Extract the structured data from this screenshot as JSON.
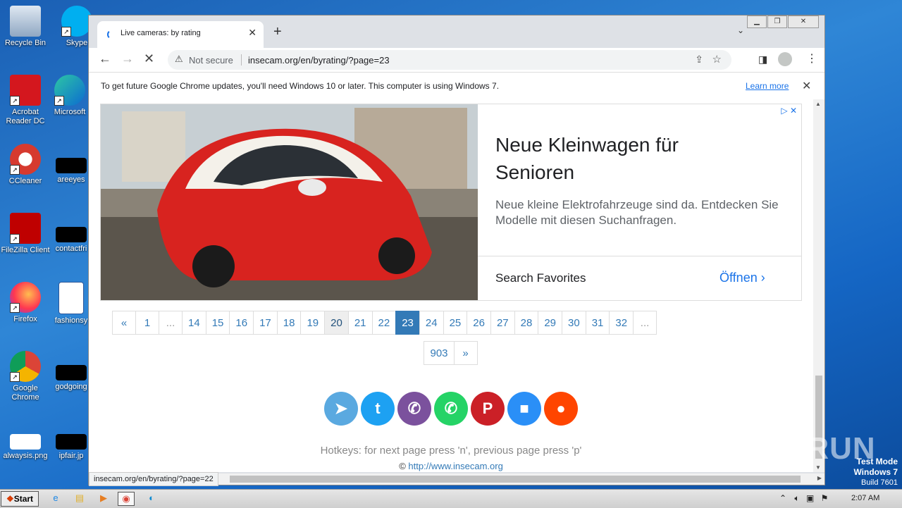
{
  "desktop": {
    "icons": [
      {
        "label": "Recycle Bin"
      },
      {
        "label": "Skype"
      },
      {
        "label": "Acrobat Reader DC"
      },
      {
        "label": "Microsoft"
      },
      {
        "label": "CCleaner"
      },
      {
        "label": "areeyes"
      },
      {
        "label": "FileZilla Client"
      },
      {
        "label": "contactfri"
      },
      {
        "label": "Firefox"
      },
      {
        "label": "fashionsy"
      },
      {
        "label": "Google Chrome"
      },
      {
        "label": "godgoing"
      },
      {
        "label": "alwaysis.png"
      },
      {
        "label": "ipfair.jp"
      }
    ]
  },
  "browser": {
    "tab_title": "Live cameras: by rating",
    "omnibox": {
      "security": "Not secure",
      "url": "insecam.org/en/byrating/?page=23"
    },
    "infobar": {
      "message": "To get future Google Chrome updates, you'll need Windows 10 or later. This computer is using Windows 7.",
      "link": "Learn more"
    },
    "status_url": "insecam.org/en/byrating/?page=22"
  },
  "ad": {
    "headline": "Neue Kleinwagen für Senioren",
    "description": "Neue kleine Elektrofahrzeuge sind da. Entdecken Sie Modelle mit diesen Suchanfragen.",
    "search_label": "Search Favorites",
    "cta": "Öffnen"
  },
  "pagination": {
    "row1": [
      "«",
      "1",
      "...",
      "14",
      "15",
      "16",
      "17",
      "18",
      "19",
      "20",
      "21",
      "22",
      "23",
      "24",
      "25",
      "26",
      "27",
      "28",
      "29",
      "30",
      "31",
      "32",
      "..."
    ],
    "row2": [
      "903",
      "»"
    ],
    "current": "23",
    "hovered": "20"
  },
  "social": [
    {
      "name": "telegram",
      "glyph": "➤",
      "color": "#5aa9e0"
    },
    {
      "name": "twitter",
      "glyph": "t",
      "color": "#1da1f2"
    },
    {
      "name": "viber",
      "glyph": "✆",
      "color": "#7b519d"
    },
    {
      "name": "whatsapp",
      "glyph": "✆",
      "color": "#25d366"
    },
    {
      "name": "pinterest",
      "glyph": "P",
      "color": "#cb2027"
    },
    {
      "name": "delicious",
      "glyph": "■",
      "color": "#2a8ff7"
    },
    {
      "name": "reddit",
      "glyph": "●",
      "color": "#ff4500"
    }
  ],
  "footer": {
    "hotkeys": "Hotkeys: for next page press 'n', previous page press 'p'",
    "copyright_symbol": "©",
    "site_link": "http://www.insecam.org"
  },
  "overlay": {
    "watermark": "ANY RUN",
    "testmode_line1": "Test Mode",
    "testmode_line2": "Windows 7",
    "testmode_line3": "Build 7601"
  },
  "taskbar": {
    "start_label": "Start",
    "clock": "2:07 AM"
  }
}
